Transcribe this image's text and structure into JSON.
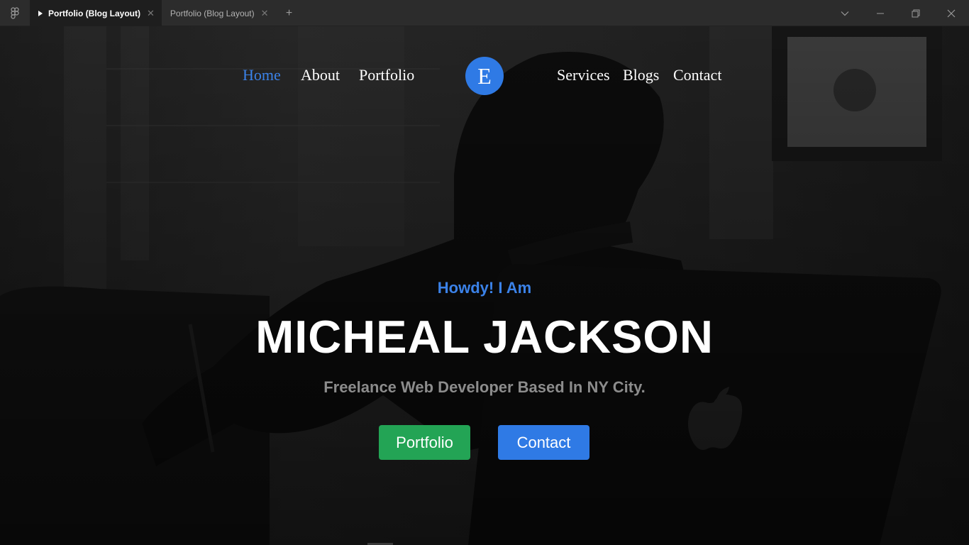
{
  "window": {
    "tabs": [
      {
        "label": "Portfolio (Blog Layout)",
        "active": true
      },
      {
        "label": "Portfolio (Blog Layout)",
        "active": false
      }
    ],
    "new_tab_label": "+",
    "close_glyph": "✕"
  },
  "nav": {
    "left_items": [
      "Home",
      "About",
      "Portfolio"
    ],
    "right_items": [
      "Services",
      "Blogs",
      "Contact"
    ],
    "active_item": "Home",
    "logo_letter": "E"
  },
  "hero": {
    "greeting": "Howdy! I Am",
    "name": "MICHEAL JACKSON",
    "tagline": "Freelance Web Developer Based In NY City.",
    "buttons": {
      "portfolio": "Portfolio",
      "contact": "Contact"
    }
  },
  "colors": {
    "accent_blue": "#2f7ae5",
    "accent_green": "#23a455",
    "tab_bar": "#2c2c2c"
  },
  "icons": [
    "figma-logo-icon",
    "play-icon",
    "close-icon",
    "plus-icon",
    "chevron-down-icon",
    "minimize-icon",
    "restore-icon",
    "window-close-icon"
  ]
}
